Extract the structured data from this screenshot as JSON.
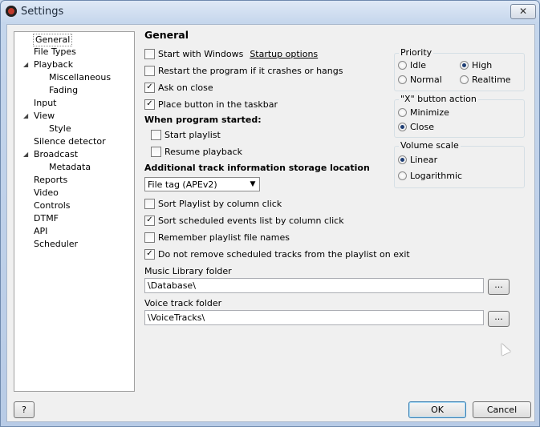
{
  "window": {
    "title": "Settings",
    "close_glyph": "✕"
  },
  "tree": {
    "items": [
      {
        "label": "General",
        "level": 0,
        "selected": true
      },
      {
        "label": "File Types",
        "level": 0
      },
      {
        "label": "Playback",
        "level": 0,
        "expanded": true
      },
      {
        "label": "Miscellaneous",
        "level": 1
      },
      {
        "label": "Fading",
        "level": 1
      },
      {
        "label": "Input",
        "level": 0
      },
      {
        "label": "View",
        "level": 0,
        "expanded": true
      },
      {
        "label": "Style",
        "level": 1
      },
      {
        "label": "Silence detector",
        "level": 0
      },
      {
        "label": "Broadcast",
        "level": 0,
        "expanded": true
      },
      {
        "label": "Metadata",
        "level": 1
      },
      {
        "label": "Reports",
        "level": 0
      },
      {
        "label": "Video",
        "level": 0
      },
      {
        "label": "Controls",
        "level": 0
      },
      {
        "label": "DTMF",
        "level": 0
      },
      {
        "label": "API",
        "level": 0
      },
      {
        "label": "Scheduler",
        "level": 0
      }
    ],
    "expand_glyph": "◢"
  },
  "general": {
    "title": "General",
    "start_with_windows": {
      "label": "Start with Windows",
      "checked": false
    },
    "startup_options_link": "Startup options",
    "restart_on_crash": {
      "label": "Restart the program if it crashes or hangs",
      "checked": false
    },
    "ask_on_close": {
      "label": "Ask on close",
      "checked": true
    },
    "place_button_taskbar": {
      "label": "Place button in the taskbar",
      "checked": true
    },
    "when_program_started": "When program started:",
    "start_playlist": {
      "label": "Start playlist",
      "checked": false
    },
    "resume_playback": {
      "label": "Resume playback",
      "checked": false
    },
    "storage_location_label": "Additional track information storage location",
    "storage_location_value": "File tag (APEv2)",
    "sort_playlist": {
      "label": "Sort Playlist by column click",
      "checked": false
    },
    "sort_scheduled": {
      "label": "Sort scheduled events list by column click",
      "checked": true
    },
    "remember_names": {
      "label": "Remember playlist file names",
      "checked": false
    },
    "dont_remove_scheduled": {
      "label": "Do not remove scheduled tracks from the playlist on exit",
      "checked": true
    },
    "music_library_label": "Music Library folder",
    "music_library_value": "\\Database\\",
    "voice_track_label": "Voice track folder",
    "voice_track_value": "\\VoiceTracks\\",
    "browse_label": "..."
  },
  "priority": {
    "title": "Priority",
    "options": [
      {
        "label": "Idle",
        "selected": false
      },
      {
        "label": "High",
        "selected": true
      },
      {
        "label": "Normal",
        "selected": false
      },
      {
        "label": "Realtime",
        "selected": false
      }
    ]
  },
  "x_button_action": {
    "title": "\"X\" button action",
    "options": [
      {
        "label": "Minimize",
        "selected": false
      },
      {
        "label": "Close",
        "selected": true
      }
    ]
  },
  "volume_scale": {
    "title": "Volume scale",
    "options": [
      {
        "label": "Linear",
        "selected": true
      },
      {
        "label": "Logarithmic",
        "selected": false
      }
    ]
  },
  "footer": {
    "help_label": "?",
    "ok_label": "OK",
    "cancel_label": "Cancel"
  },
  "check_glyph": "✓",
  "combo_arrow_glyph": "▼"
}
